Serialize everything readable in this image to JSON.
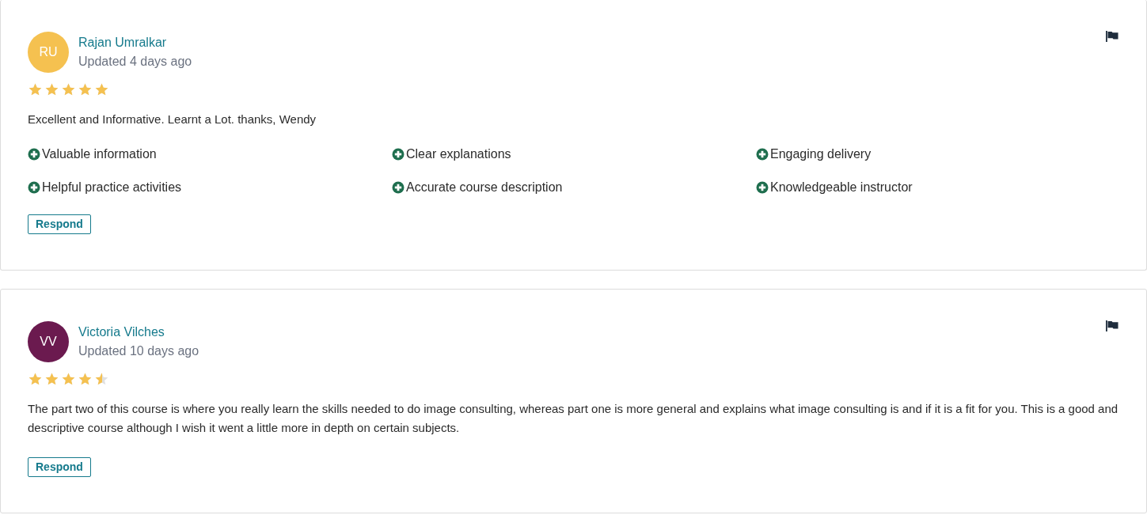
{
  "reviews": [
    {
      "initials": "RU",
      "color": "#f5c150",
      "name": "Rajan Umralkar",
      "updated": "Updated 4 days ago",
      "stars": 5,
      "text": "Excellent and Informative. Learnt a Lot. thanks, Wendy",
      "highlights": [
        "Valuable information",
        "Clear explanations",
        "Engaging delivery",
        "Helpful practice activities",
        "Accurate course description",
        "Knowledgeable instructor"
      ],
      "button": "Respond"
    },
    {
      "initials": "VV",
      "color": "#6b1a4f",
      "name": "Victoria Vilches",
      "updated": "Updated 10 days ago",
      "stars": 4.5,
      "text": "The part two of this course is where you really learn the skills needed to do image consulting, whereas part one is more general and explains what image consulting is and if it is a fit for you. This is a good and descriptive course although I wish it went a little more in depth on certain subjects.",
      "button": "Respond"
    }
  ]
}
